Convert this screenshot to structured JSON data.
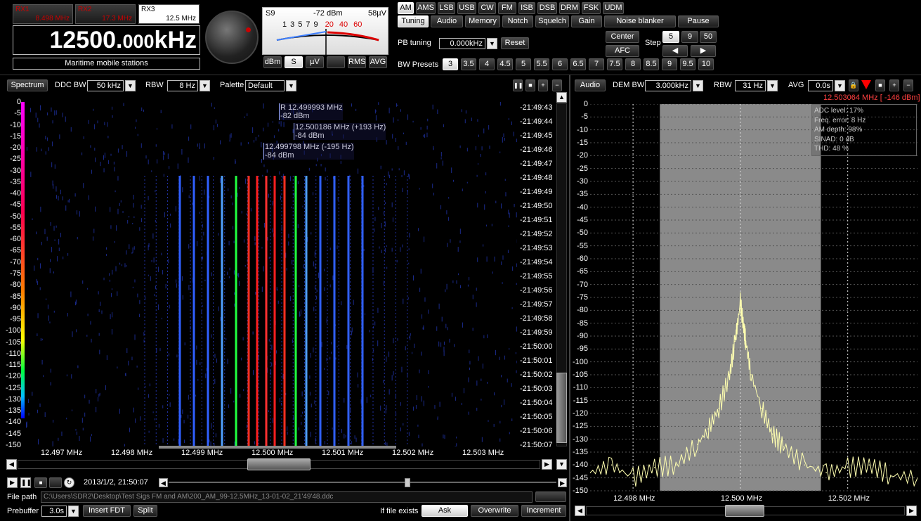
{
  "rx": [
    {
      "name": "RX1",
      "freq": "8.498 MHz"
    },
    {
      "name": "RX2",
      "freq": "17.3 MHz"
    },
    {
      "name": "RX3",
      "freq": "12.5 MHz"
    }
  ],
  "main_freq": {
    "big": "12500.",
    "small": "000",
    "unit": "kHz"
  },
  "station_label": "Maritime mobile stations",
  "meter": {
    "scale_label": "S9",
    "dbm": "-72 dBm",
    "uv": "58µV",
    "ticks": [
      "1",
      "3",
      "5",
      "7",
      "9",
      "20",
      "40",
      "60"
    ],
    "btn_dbm": "dBm",
    "btn_s": "S",
    "btn_uv": "µV",
    "btn_rms": "RMS",
    "btn_avg": "AVG"
  },
  "modes": [
    "AM",
    "AMS",
    "LSB",
    "USB",
    "CW",
    "FM",
    "ISB",
    "DSB",
    "DRM",
    "FSK",
    "UDM"
  ],
  "tabs": [
    "Tuning",
    "Audio",
    "Memory",
    "Notch",
    "Squelch",
    "Gain",
    "Noise blanker",
    "Pause"
  ],
  "tuning": {
    "pb_label": "PB tuning",
    "pb_value": "0.000kHz",
    "reset": "Reset",
    "center": "Center",
    "afc": "AFC",
    "step_label": "Step",
    "steps": [
      "5",
      "9",
      "50"
    ],
    "bw_label": "BW Presets",
    "bw_presets": [
      "3",
      "3.5",
      "4",
      "4.5",
      "5",
      "5.5",
      "6",
      "6.5",
      "7",
      "7.5",
      "8",
      "8.5",
      "9",
      "9.5",
      "10"
    ]
  },
  "spectrum_bar": {
    "spectrum_btn": "Spectrum",
    "ddc_label": "DDC BW",
    "ddc_value": "50 kHz",
    "rbw_label": "RBW",
    "rbw_value": "8 Hz",
    "palette_label": "Palette",
    "palette_value": "Default"
  },
  "audio_bar": {
    "audio_btn": "Audio",
    "dem_label": "DEM BW",
    "dem_value": "3.000kHz",
    "rbw_label": "RBW",
    "rbw_value": "31 Hz",
    "avg_label": "AVG",
    "avg_value": "0.0s",
    "cursor_readout": "12.503064 MHz [ -146 dBm]"
  },
  "left_y_ticks": [
    "0",
    "-5",
    "-10",
    "-15",
    "-20",
    "-25",
    "-30",
    "-35",
    "-40",
    "-45",
    "-50",
    "-55",
    "-60",
    "-65",
    "-70",
    "-75",
    "-80",
    "-85",
    "-90",
    "-95",
    "-100",
    "-105",
    "-110",
    "-115",
    "-120",
    "-125",
    "-130",
    "-135",
    "-140",
    "-145",
    "-150"
  ],
  "right_y_ticks": [
    "0",
    "-5",
    "-10",
    "-15",
    "-20",
    "-25",
    "-30",
    "-35",
    "-40",
    "-45",
    "-50",
    "-55",
    "-60",
    "-65",
    "-70",
    "-75",
    "-80",
    "-85",
    "-90",
    "-95",
    "-100",
    "-105",
    "-110",
    "-115",
    "-120",
    "-125",
    "-130",
    "-135",
    "-140",
    "-145",
    "-150"
  ],
  "left_x_ticks": [
    "12.497 MHz",
    "12.498 MHz",
    "12.499 MHz",
    "12.500 MHz",
    "12.501 MHz",
    "12.502 MHz",
    "12.503 MHz"
  ],
  "right_x_ticks": [
    "12.498 MHz",
    "12.500 MHz",
    "12.502 MHz"
  ],
  "times": [
    "-21:49:43",
    "-21:49:44",
    "-21:49:45",
    "-21:49:46",
    "-21:49:47",
    "-21:49:48",
    "-21:49:49",
    "-21:49:50",
    "-21:49:51",
    "-21:49:52",
    "-21:49:53",
    "-21:49:54",
    "-21:49:55",
    "-21:49:56",
    "-21:49:57",
    "-21:49:58",
    "-21:49:59",
    "-21:50:00",
    "-21:50:01",
    "-21:50:02",
    "-21:50:03",
    "-21:50:04",
    "-21:50:05",
    "-21:50:06",
    "-21:50:07"
  ],
  "markers": [
    {
      "l1": "R 12.499993 MHz",
      "l2": "-82 dBm"
    },
    {
      "l1": "12.500186 MHz (+193 Hz)",
      "l2": "-84 dBm"
    },
    {
      "l1": "12.499798 MHz (-195 Hz)",
      "l2": "-84 dBm"
    }
  ],
  "stats": [
    "ADC level: 17%",
    "Freq. error: 8 Hz",
    "AM depth: 98%",
    "SINAD: 0 dB",
    "THD: 48 %"
  ],
  "waterfall_lines": [
    {
      "f": 12.4987,
      "c": "#3060ff"
    },
    {
      "f": 12.4989,
      "c": "#3060ff"
    },
    {
      "f": 12.4991,
      "c": "#3060ff"
    },
    {
      "f": 12.4993,
      "c": "#50a0ff"
    },
    {
      "f": 12.4995,
      "c": "#20ff40"
    },
    {
      "f": 12.49968,
      "c": "#ff3020"
    },
    {
      "f": 12.4998,
      "c": "#ff2020"
    },
    {
      "f": 12.49993,
      "c": "#ff3030"
    },
    {
      "f": 12.50005,
      "c": "#ff2020"
    },
    {
      "f": 12.50019,
      "c": "#ff3020"
    },
    {
      "f": 12.50035,
      "c": "#20ff40"
    },
    {
      "f": 12.5005,
      "c": "#50a0ff"
    },
    {
      "f": 12.5007,
      "c": "#3060ff"
    },
    {
      "f": 12.5009,
      "c": "#3060ff"
    },
    {
      "f": 12.5011,
      "c": "#3060ff"
    },
    {
      "f": 12.5013,
      "c": "#3060ff"
    }
  ],
  "playback": {
    "datetime": "2013/1/2, 21:50:07",
    "file_path_label": "File path",
    "file_path": "C:\\Users\\SDR2\\Desktop\\Test Sigs FM and AM\\200_AM_99-12.5MHz_13-01-02_21'49'48.ddc",
    "prebuffer_label": "Prebuffer",
    "prebuffer": "3.0s",
    "insert_fdt": "Insert FDT",
    "split": "Split",
    "if_exists": "If file exists",
    "ask": "Ask",
    "overwrite": "Overwrite",
    "increment": "Increment"
  },
  "chart_data": [
    {
      "type": "heatmap",
      "title": "",
      "xlabel": "",
      "ylabel": "",
      "xlim": [
        12.4965,
        12.5035
      ],
      "ylim": [
        -150,
        0
      ],
      "x_ticks": [
        "12.497 MHz",
        "12.498 MHz",
        "12.499 MHz",
        "12.500 MHz",
        "12.501 MHz",
        "12.502 MHz",
        "12.503 MHz"
      ]
    },
    {
      "type": "line",
      "title": "",
      "xlabel": "",
      "ylabel": "",
      "xlim": [
        12.4972,
        12.5033
      ],
      "ylim": [
        -150,
        0
      ],
      "x": [
        12.4972,
        12.4976,
        12.498,
        12.4984,
        12.4988,
        12.4992,
        12.4994,
        12.4996,
        12.4998,
        12.4999,
        12.49993,
        12.5,
        12.50007,
        12.5001,
        12.5002,
        12.5004,
        12.5006,
        12.5008,
        12.5012,
        12.5016,
        12.502,
        12.5024,
        12.5028,
        12.5033
      ],
      "y": [
        -143,
        -140,
        -145,
        -141,
        -140,
        -132,
        -126,
        -118,
        -105,
        -92,
        -88,
        -77,
        -88,
        -92,
        -105,
        -118,
        -128,
        -133,
        -140,
        -143,
        -141,
        -140,
        -144,
        -145
      ],
      "passband": [
        12.4985,
        12.5015
      ]
    }
  ]
}
